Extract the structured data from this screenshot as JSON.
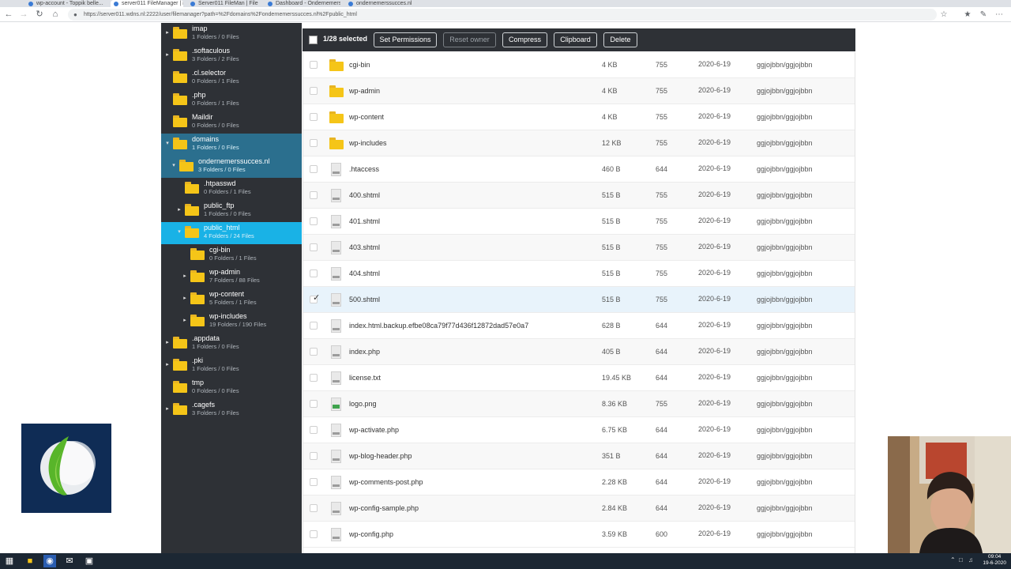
{
  "browser": {
    "tabs": [
      {
        "label": "wp-account - Toppik belle..."
      },
      {
        "label": "server011 FileManager | File Ma..."
      },
      {
        "label": "Server011 FileMan | File Man..."
      },
      {
        "label": "Dashboard - Ondernemers..."
      },
      {
        "label": "ondernemerssucces.nl"
      }
    ],
    "url": "https://server011.wdns.nl:2222/user/filemanager?path=%2Fdomains%2Fondernemerssucces.nl%2Fpublic_html"
  },
  "tree": {
    "nodes": [
      {
        "name": "imap",
        "sub": "1 Folders / 0 Files",
        "arrow": "▸",
        "depth": 0,
        "state": ""
      },
      {
        "name": ".softaculous",
        "sub": "3 Folders / 2 Files",
        "arrow": "▸",
        "depth": 0,
        "state": ""
      },
      {
        "name": ".cl.selector",
        "sub": "0 Folders / 1 Files",
        "arrow": "",
        "depth": 0,
        "state": ""
      },
      {
        "name": ".php",
        "sub": "0 Folders / 1 Files",
        "arrow": "",
        "depth": 0,
        "state": ""
      },
      {
        "name": "Maildir",
        "sub": "0 Folders / 0 Files",
        "arrow": "",
        "depth": 0,
        "state": ""
      },
      {
        "name": "domains",
        "sub": "1 Folders / 0 Files",
        "arrow": "▾",
        "depth": 0,
        "state": "open"
      },
      {
        "name": "ondernemerssucces.nl",
        "sub": "3 Folders / 0 Files",
        "arrow": "▾",
        "depth": 1,
        "state": "open"
      },
      {
        "name": ".htpasswd",
        "sub": "0 Folders / 1 Files",
        "arrow": "",
        "depth": 2,
        "state": ""
      },
      {
        "name": "public_ftp",
        "sub": "1 Folders / 0 Files",
        "arrow": "▸",
        "depth": 2,
        "state": ""
      },
      {
        "name": "public_html",
        "sub": "4 Folders / 24 Files",
        "arrow": "▾",
        "depth": 2,
        "state": "selected"
      },
      {
        "name": "cgi-bin",
        "sub": "0 Folders / 1 Files",
        "arrow": "",
        "depth": 3,
        "state": ""
      },
      {
        "name": "wp-admin",
        "sub": "7 Folders / 88 Files",
        "arrow": "▸",
        "depth": 3,
        "state": ""
      },
      {
        "name": "wp-content",
        "sub": "5 Folders / 1 Files",
        "arrow": "▸",
        "depth": 3,
        "state": ""
      },
      {
        "name": "wp-includes",
        "sub": "19 Folders / 190 Files",
        "arrow": "▸",
        "depth": 3,
        "state": ""
      },
      {
        "name": ".appdata",
        "sub": "1 Folders / 0 Files",
        "arrow": "▸",
        "depth": 0,
        "state": ""
      },
      {
        "name": ".pki",
        "sub": "1 Folders / 0 Files",
        "arrow": "▸",
        "depth": 0,
        "state": ""
      },
      {
        "name": "tmp",
        "sub": "0 Folders / 0 Files",
        "arrow": "",
        "depth": 0,
        "state": ""
      },
      {
        "name": ".cagefs",
        "sub": "3 Folders / 0 Files",
        "arrow": "▸",
        "depth": 0,
        "state": ""
      }
    ]
  },
  "toolbar": {
    "selected": "1/28 selected",
    "buttons": [
      {
        "label": "Set Permissions",
        "disabled": false
      },
      {
        "label": "Reset owner",
        "disabled": true
      },
      {
        "label": "Compress",
        "disabled": false
      },
      {
        "label": "Clipboard",
        "disabled": false
      },
      {
        "label": "Delete",
        "disabled": false
      }
    ]
  },
  "files": [
    {
      "name": "cgi-bin",
      "kind": "folder",
      "size": "4 KB",
      "perm": "755",
      "date": "2020-6-19",
      "owner": "ggjojbbn/ggjojbbn"
    },
    {
      "name": "wp-admin",
      "kind": "folder",
      "size": "4 KB",
      "perm": "755",
      "date": "2020-6-19",
      "owner": "ggjojbbn/ggjojbbn"
    },
    {
      "name": "wp-content",
      "kind": "folder",
      "size": "4 KB",
      "perm": "755",
      "date": "2020-6-19",
      "owner": "ggjojbbn/ggjojbbn"
    },
    {
      "name": "wp-includes",
      "kind": "folder",
      "size": "12 KB",
      "perm": "755",
      "date": "2020-6-19",
      "owner": "ggjojbbn/ggjojbbn"
    },
    {
      "name": ".htaccess",
      "kind": "file",
      "size": "460 B",
      "perm": "644",
      "date": "2020-6-19",
      "owner": "ggjojbbn/ggjojbbn"
    },
    {
      "name": "400.shtml",
      "kind": "file",
      "size": "515 B",
      "perm": "755",
      "date": "2020-6-19",
      "owner": "ggjojbbn/ggjojbbn"
    },
    {
      "name": "401.shtml",
      "kind": "file",
      "size": "515 B",
      "perm": "755",
      "date": "2020-6-19",
      "owner": "ggjojbbn/ggjojbbn"
    },
    {
      "name": "403.shtml",
      "kind": "file",
      "size": "515 B",
      "perm": "755",
      "date": "2020-6-19",
      "owner": "ggjojbbn/ggjojbbn"
    },
    {
      "name": "404.shtml",
      "kind": "file",
      "size": "515 B",
      "perm": "755",
      "date": "2020-6-19",
      "owner": "ggjojbbn/ggjojbbn"
    },
    {
      "name": "500.shtml",
      "kind": "file",
      "size": "515 B",
      "perm": "755",
      "date": "2020-6-19",
      "owner": "ggjojbbn/ggjojbbn",
      "hover": true
    },
    {
      "name": "index.html.backup.efbe08ca79f77d436f12872dad57e0a7",
      "kind": "file",
      "size": "628 B",
      "perm": "644",
      "date": "2020-6-19",
      "owner": "ggjojbbn/ggjojbbn"
    },
    {
      "name": "index.php",
      "kind": "file",
      "size": "405 B",
      "perm": "644",
      "date": "2020-6-19",
      "owner": "ggjojbbn/ggjojbbn"
    },
    {
      "name": "license.txt",
      "kind": "file",
      "size": "19.45 KB",
      "perm": "644",
      "date": "2020-6-19",
      "owner": "ggjojbbn/ggjojbbn"
    },
    {
      "name": "logo.png",
      "kind": "image",
      "size": "8.36 KB",
      "perm": "755",
      "date": "2020-6-19",
      "owner": "ggjojbbn/ggjojbbn"
    },
    {
      "name": "wp-activate.php",
      "kind": "file",
      "size": "6.75 KB",
      "perm": "644",
      "date": "2020-6-19",
      "owner": "ggjojbbn/ggjojbbn"
    },
    {
      "name": "wp-blog-header.php",
      "kind": "file",
      "size": "351 B",
      "perm": "644",
      "date": "2020-6-19",
      "owner": "ggjojbbn/ggjojbbn"
    },
    {
      "name": "wp-comments-post.php",
      "kind": "file",
      "size": "2.28 KB",
      "perm": "644",
      "date": "2020-6-19",
      "owner": "ggjojbbn/ggjojbbn"
    },
    {
      "name": "wp-config-sample.php",
      "kind": "file",
      "size": "2.84 KB",
      "perm": "644",
      "date": "2020-6-19",
      "owner": "ggjojbbn/ggjojbbn"
    },
    {
      "name": "wp-config.php",
      "kind": "file",
      "size": "3.59 KB",
      "perm": "600",
      "date": "2020-6-19",
      "owner": "ggjojbbn/ggjojbbn"
    }
  ],
  "taskbar": {
    "time": "09:04",
    "date": "19-6-2020"
  },
  "colors": {
    "tree_bg": "#2e3136",
    "tree_open": "#2b6f8e",
    "tree_selected": "#19b2e6",
    "folder": "#f5c518"
  }
}
